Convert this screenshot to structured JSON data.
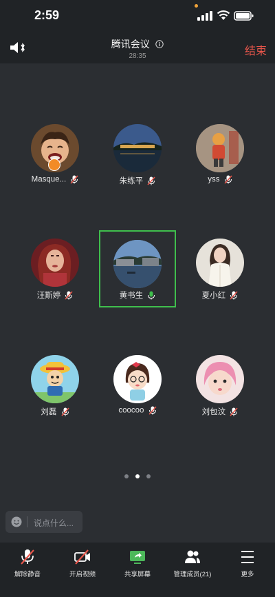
{
  "status_bar": {
    "time": "2:59"
  },
  "header": {
    "title": "腾讯会议",
    "duration": "28:35",
    "end_label": "结束"
  },
  "participants": [
    {
      "name": "Masque...",
      "avatar": "anime-boy",
      "host": true,
      "mic": "muted"
    },
    {
      "name": "朱练平",
      "avatar": "night-lake",
      "mic": "muted"
    },
    {
      "name": "yss",
      "avatar": "figurine",
      "mic": "muted"
    },
    {
      "name": "汪斯婷",
      "avatar": "woman-red-hair",
      "mic": "muted"
    },
    {
      "name": "黄书生",
      "avatar": "river-town",
      "mic": "active",
      "speaking": true
    },
    {
      "name": "夏小红",
      "avatar": "woman-white-dress",
      "mic": "muted"
    },
    {
      "name": "刘磊",
      "avatar": "luffy-cartoon",
      "mic": "muted"
    },
    {
      "name": "coocoo",
      "avatar": "cartoon-girl",
      "mic": "muted"
    },
    {
      "name": "刘包汶",
      "avatar": "pink-hair-child",
      "mic": "muted"
    }
  ],
  "pagination": {
    "current": 2,
    "total": 3
  },
  "chat": {
    "placeholder": "说点什么..."
  },
  "toolbar": {
    "unmute": "解除静音",
    "video": "开启视频",
    "share": "共享屏幕",
    "members": "管理成员(21)",
    "more": "更多"
  },
  "colors": {
    "accent_green": "#3fbf4d",
    "end_red": "#e8564b",
    "background": "#2b2e32"
  }
}
